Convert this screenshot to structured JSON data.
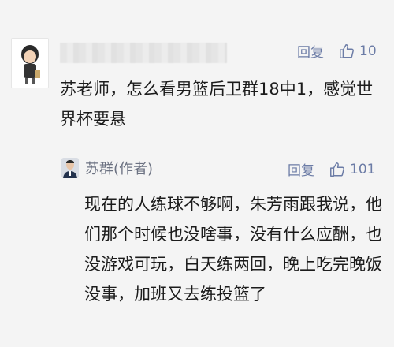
{
  "comment": {
    "reply_label": "回复",
    "like_count": "10",
    "text": "苏老师，怎么看男篮后卫群18中1，感觉世\n界杯要悬"
  },
  "reply": {
    "author": "苏群(作者)",
    "reply_label": "回复",
    "like_count": "101",
    "text": "现在的人练球不够啊，朱芳雨跟我说，他\n们那个时候也没啥事，没有什么应酬，也\n没游戏可玩，白天练两回，晚上吃完晚饭\n没事，加班又去练投篮了"
  },
  "colors": {
    "background": "#f4f4f4",
    "link": "#6c7ca6",
    "text": "#1c1c1c"
  }
}
